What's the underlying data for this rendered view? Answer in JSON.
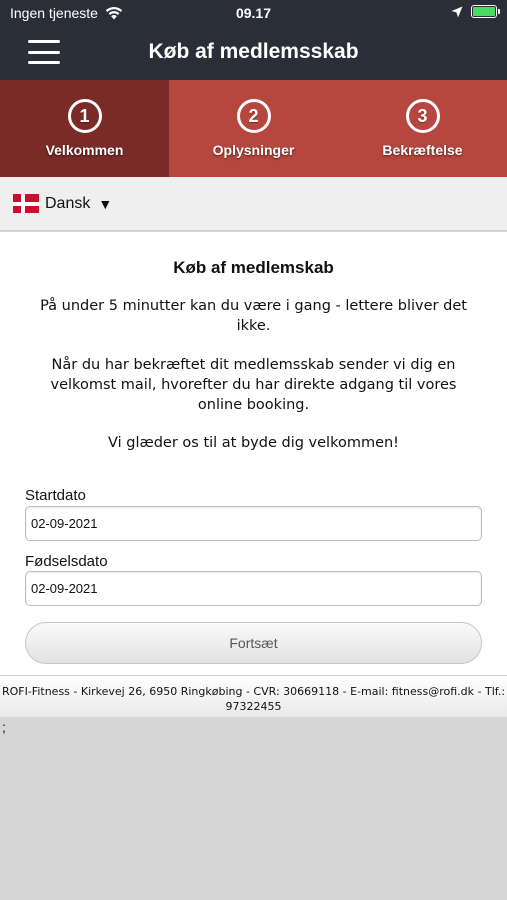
{
  "status_bar": {
    "carrier": "Ingen tjeneste",
    "time": "09.17"
  },
  "header": {
    "title": "Køb af medlemsskab"
  },
  "steps": [
    {
      "number": "1",
      "label": "Velkommen",
      "active": true
    },
    {
      "number": "2",
      "label": "Oplysninger",
      "active": false
    },
    {
      "number": "3",
      "label": "Bekræftelse",
      "active": false
    }
  ],
  "language": {
    "selected": "Dansk",
    "caret": "▼"
  },
  "main": {
    "title": "Køb af medlemskab",
    "paragraph1": "På under 5 minutter kan du være i gang - lettere bliver det ikke.",
    "paragraph2": "Når du har bekræftet dit medlemsskab sender vi dig en velkomst mail, hvorefter du har direkte adgang til vores online booking.",
    "paragraph3": "Vi glæder os til at byde dig velkommen!"
  },
  "form": {
    "start_label": "Startdato",
    "start_value": "02-09-2021",
    "birth_label": "Fødselsdato",
    "birth_value": "02-09-2021",
    "continue_label": "Fortsæt"
  },
  "footer": {
    "text": "ROFI-Fitness - Kirkevej 26, 6950 Ringkøbing - CVR: 30669118 - E-mail: fitness@rofi.dk - Tlf.: 97322455"
  },
  "stray_text": ";",
  "colors": {
    "header_bg": "#2a2e38",
    "step_bg": "#b5473f",
    "step_active_bg": "#7a2b28",
    "battery": "#4cd964"
  }
}
